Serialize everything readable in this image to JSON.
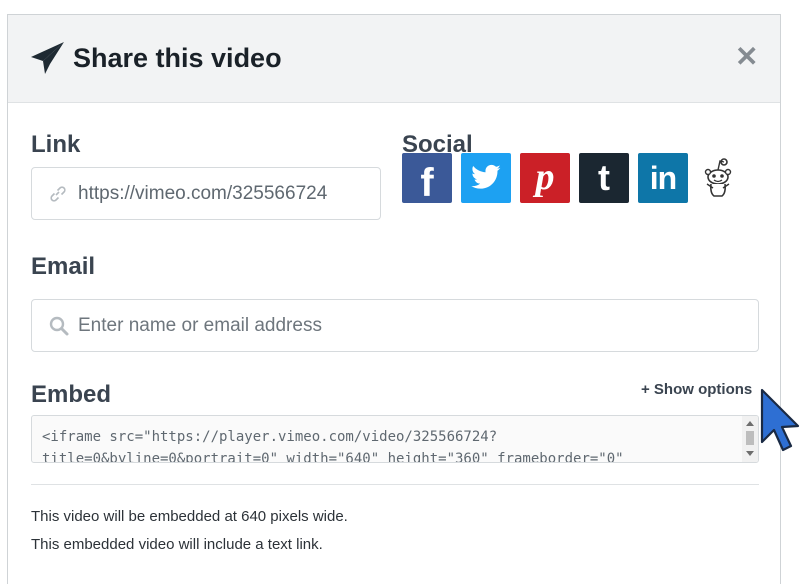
{
  "modal": {
    "title": "Share this video",
    "close_icon": "close-icon",
    "header_icon": "paper-plane-icon"
  },
  "link": {
    "label": "Link",
    "value": "https://vimeo.com/325566724",
    "icon": "link-icon"
  },
  "social": {
    "label": "Social",
    "buttons": [
      {
        "name": "facebook",
        "glyph": "f",
        "color": "#3b5998"
      },
      {
        "name": "twitter",
        "glyph": "twitter-bird",
        "color": "#1da1f2"
      },
      {
        "name": "pinterest",
        "glyph": "p",
        "color": "#cb2027"
      },
      {
        "name": "tumblr",
        "glyph": "t",
        "color": "#1b2731"
      },
      {
        "name": "linkedin",
        "glyph": "in",
        "color": "#0e76a8"
      },
      {
        "name": "reddit",
        "glyph": "reddit-alien",
        "color": "#ffffff"
      }
    ]
  },
  "email": {
    "label": "Email",
    "placeholder": "Enter name or email address",
    "icon": "search-icon"
  },
  "embed": {
    "label": "Embed",
    "show_options": "+ Show options",
    "code": "<iframe src=\"https://player.vimeo.com/video/325566724?\ntitle=0&byline=0&portrait=0\" width=\"640\" height=\"360\" frameborder=\"0\""
  },
  "info": {
    "line1": "This video will be embedded at 640 pixels wide.",
    "line2": "This embedded video will include a text link."
  }
}
